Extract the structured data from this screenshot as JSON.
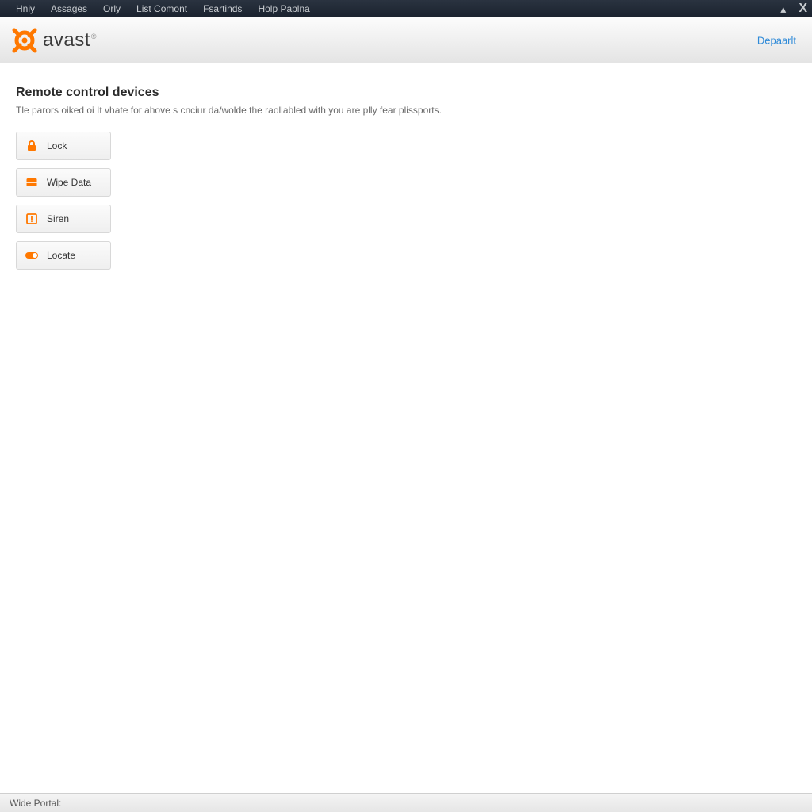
{
  "menubar": {
    "items": [
      "Hniy",
      "Assages",
      "Orly",
      "List Comont",
      "Fsartinds",
      "Holp Paplna"
    ]
  },
  "header": {
    "brand": "avast",
    "link": "Depaarlt"
  },
  "page": {
    "title": "Remote control devices",
    "description": "Tle parors oiked oi It vhate for ahove s cnciur da/wolde the raollabled with you are plly fear plissports."
  },
  "actions": [
    {
      "label": "Lock",
      "icon": "lock-icon"
    },
    {
      "label": "Wipe Data",
      "icon": "wipe-icon"
    },
    {
      "label": "Siren",
      "icon": "siren-icon"
    },
    {
      "label": "Locate",
      "icon": "locate-icon"
    }
  ],
  "statusbar": {
    "text": "Wide Portal:"
  },
  "colors": {
    "accent": "#ff7800",
    "link": "#2e8ad8"
  }
}
